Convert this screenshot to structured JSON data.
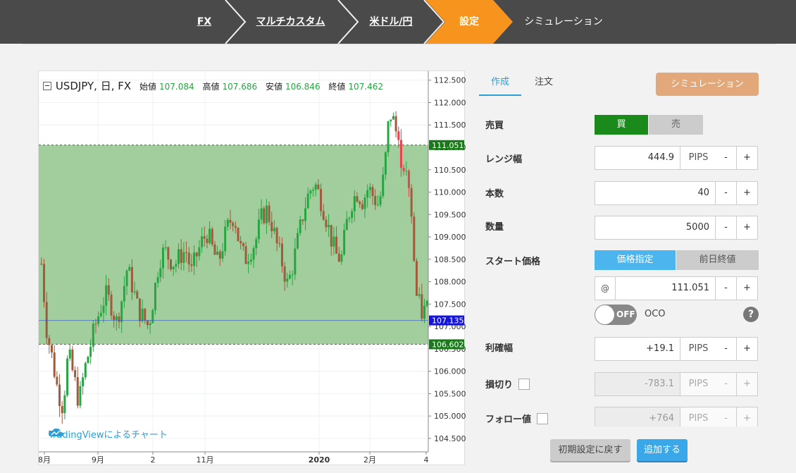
{
  "breadcrumb": {
    "steps": [
      "FX",
      "マルチカスタム",
      "米ドル/円",
      "設定",
      "シミュレーション"
    ],
    "active_color": "#f7941d",
    "bar_color": "#4a4a4a"
  },
  "chart": {
    "symbol": "USDJPY, 日, FX",
    "legend": {
      "open_label": "始値",
      "open": "107.084",
      "high_label": "高値",
      "high": "107.686",
      "low_label": "安値",
      "low": "106.846",
      "close_label": "終値",
      "close": "107.462"
    },
    "watermark": "TradingViewによるチャート",
    "price_labels": {
      "upper": "111.051",
      "current": "107.135",
      "lower": "106.602"
    },
    "colors": {
      "range_fill": "#9dcb98",
      "up": "#26a641",
      "down": "#a05a3c",
      "spike": "#e8414f",
      "current_line": "#3355cc"
    }
  },
  "chart_data": {
    "type": "candlestick",
    "y_ticks": [
      "112.500",
      "112.000",
      "111.500",
      "111.000",
      "110.500",
      "110.000",
      "109.500",
      "109.000",
      "108.500",
      "108.000",
      "107.500",
      "107.000",
      "106.500",
      "106.000",
      "105.500",
      "105.000",
      "104.500"
    ],
    "x_ticks": [
      "8月",
      "9月",
      "2",
      "11月",
      "2020",
      "2月",
      "4"
    ],
    "ylim": [
      104.2,
      112.7
    ],
    "range_band": [
      106.602,
      111.051
    ],
    "current_price": 107.135,
    "close_path": [
      108.4,
      106.9,
      106.3,
      105.6,
      105.2,
      106.4,
      105.9,
      105.3,
      106.0,
      106.5,
      107.0,
      107.4,
      107.7,
      107.5,
      107.1,
      107.6,
      108.3,
      107.9,
      107.4,
      107.2,
      107.0,
      107.7,
      108.5,
      108.7,
      108.5,
      108.4,
      108.6,
      108.7,
      108.2,
      108.6,
      108.9,
      109.1,
      108.7,
      108.4,
      108.9,
      109.3,
      109.5,
      108.8,
      108.5,
      108.7,
      108.9,
      109.4,
      109.6,
      109.3,
      108.8,
      108.4,
      107.9,
      108.4,
      109.0,
      109.6,
      110.0,
      110.2,
      109.9,
      109.5,
      109.0,
      108.6,
      108.5,
      109.3,
      109.8,
      110.0,
      109.8,
      110.1,
      109.9,
      109.7,
      110.4,
      111.8,
      111.5,
      110.8,
      110.5,
      109.6,
      107.7,
      107.3,
      107.4
    ]
  },
  "tabs": [
    "作成",
    "注文"
  ],
  "simulate_button": "シミュレーション",
  "form": {
    "side": {
      "label": "売買",
      "buy": "買",
      "sell": "売"
    },
    "range": {
      "label": "レンジ幅",
      "value": "444.9",
      "unit": "PIPS"
    },
    "count": {
      "label": "本数",
      "value": "40"
    },
    "quantity": {
      "label": "数量",
      "value": "5000"
    },
    "start_price": {
      "label": "スタート価格",
      "opt_specified": "価格指定",
      "opt_prev_close": "前日終値",
      "at": "@",
      "value": "111.051"
    },
    "oco": {
      "toggle": "OFF",
      "label": "OCO",
      "help": "?"
    },
    "take_profit": {
      "label": "利確幅",
      "value": "+19.1",
      "unit": "PIPS"
    },
    "stop_loss": {
      "label": "損切り",
      "value": "-783.1",
      "unit": "PIPS"
    },
    "follow": {
      "label": "フォロー値",
      "value": "+764",
      "unit": "PIPS"
    },
    "minus": "-",
    "plus": "+"
  },
  "buttons": {
    "reset": "初期設定に戻す",
    "add": "追加する"
  }
}
